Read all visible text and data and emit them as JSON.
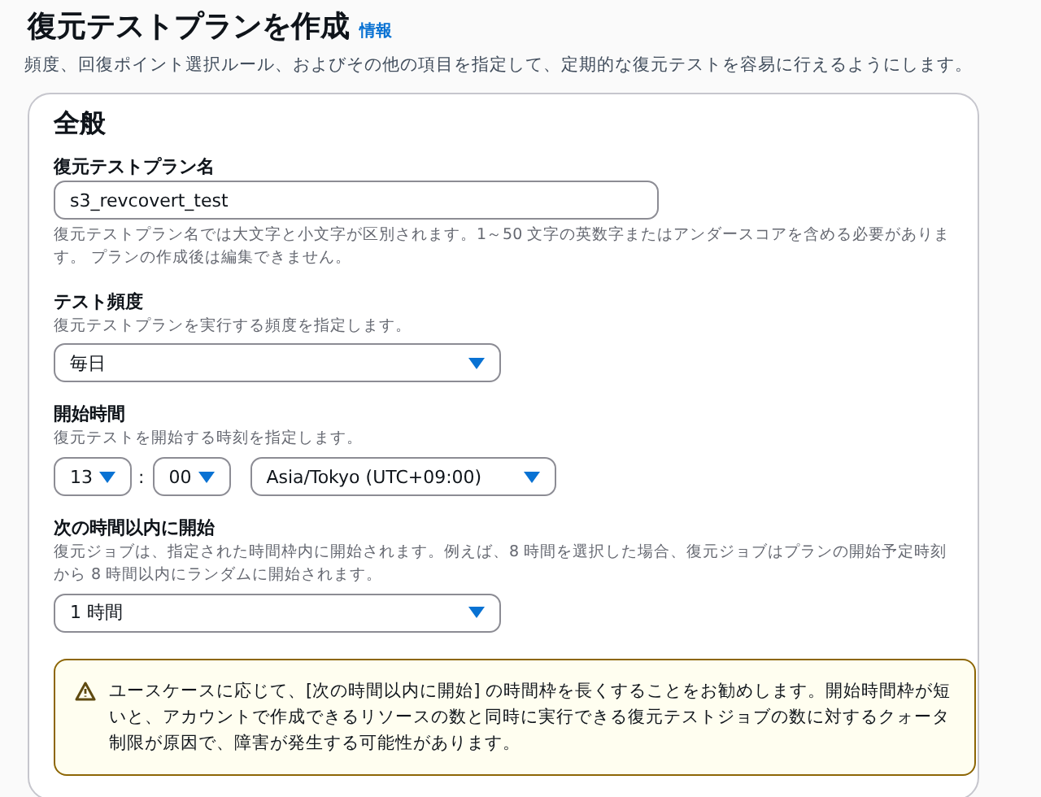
{
  "header": {
    "title": "復元テストプランを作成",
    "info_link": "情報",
    "description": "頻度、回復ポイント選択ルール、およびその他の項目を指定して、定期的な復元テストを容易に行えるようにします。"
  },
  "section": {
    "title": "全般",
    "fields": [
      {
        "kind": "text",
        "label": "復元テストプラン名",
        "value": "s3_revcovert_test",
        "hint": "復元テストプラン名では大文字と小文字が区別されます。1～50 文字の英数字またはアンダースコアを含める必要があります。 プランの作成後は編集できません。"
      },
      {
        "kind": "select",
        "label": "テスト頻度",
        "hint": "復元テストプランを実行する頻度を指定します。",
        "value": "毎日"
      },
      {
        "kind": "time",
        "label": "開始時間",
        "hint": "復元テストを開始する時刻を指定します。",
        "hour": "13",
        "separator": ":",
        "minute": "00",
        "timezone": "Asia/Tokyo (UTC+09:00)"
      },
      {
        "kind": "select",
        "label": "次の時間以内に開始",
        "hint": "復元ジョブは、指定された時間枠内に開始されます。例えば、8 時間を選択した場合、復元ジョブはプランの開始予定時刻から 8 時間以内にランダムに開始されます。",
        "value": "1 時間"
      }
    ],
    "alert": {
      "kind": "warning",
      "text": "ユースケースに応じて、[次の時間以内に開始] の時間枠を長くすることをお勧めします。開始時間枠が短いと、アカウントで作成できるリソースの数と同時に実行できる復元テストジョブの数に対するクォータ制限が原因で、障害が発生する可能性があります。"
    }
  }
}
